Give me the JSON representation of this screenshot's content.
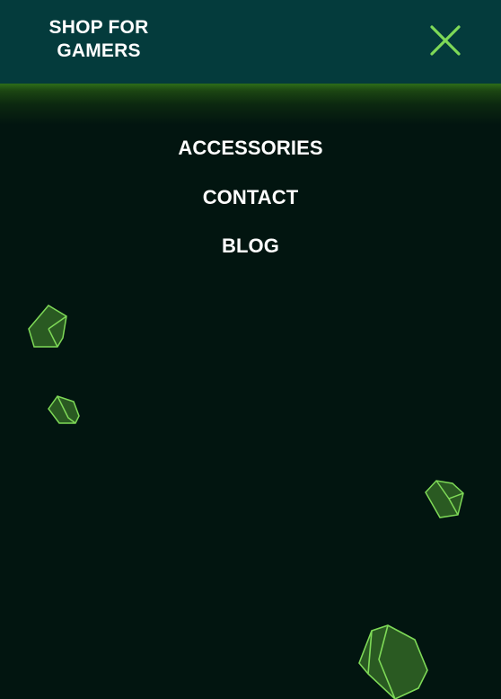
{
  "header": {
    "brand_line1": "SHOP FOR",
    "brand_line2": "GAMERS",
    "close_icon": "close-icon"
  },
  "menu": {
    "items": [
      {
        "label": "ACCESSORIES"
      },
      {
        "label": "CONTACT"
      },
      {
        "label": "BLOG"
      }
    ]
  },
  "colors": {
    "header_bg": "#043b3c",
    "page_bg": "#021510",
    "accent": "#7ed957",
    "rock_fill": "#2a5a22"
  }
}
